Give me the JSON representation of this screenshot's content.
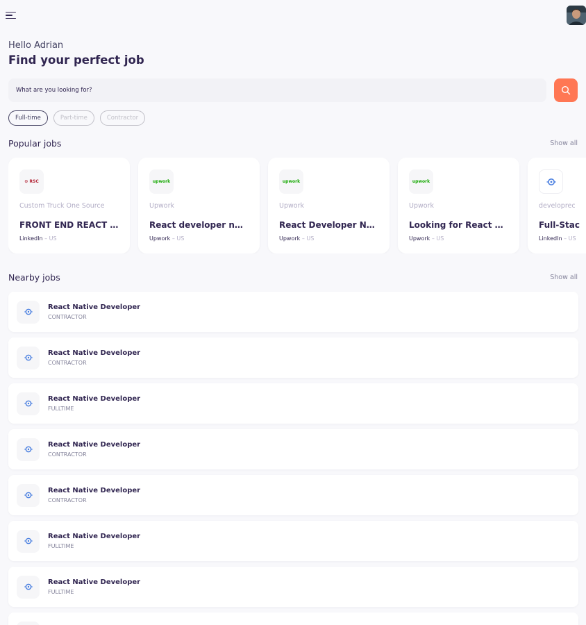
{
  "header": {
    "menu_icon": "menu-icon",
    "avatar_icon": "user-avatar"
  },
  "welcome": {
    "greeting": "Hello Adrian",
    "title": "Find your perfect job"
  },
  "search": {
    "placeholder": "What are you looking for?",
    "button_icon": "search-icon"
  },
  "job_types": [
    {
      "label": "Full-time",
      "active": true
    },
    {
      "label": "Part-time",
      "active": false
    },
    {
      "label": "Contractor",
      "active": false
    }
  ],
  "popular": {
    "title": "Popular jobs",
    "show_all": "Show all",
    "jobs": [
      {
        "logo_text": "⊙ RSC",
        "company": "Custom Truck One Source",
        "title": "FRONT END REACT ...",
        "publisher": "LinkedIn",
        "location": "US"
      },
      {
        "logo_text": "upwork",
        "company": "Upwork",
        "title": "React developer ne...",
        "publisher": "Upwork",
        "location": "US"
      },
      {
        "logo_text": "upwork",
        "company": "Upwork",
        "title": "React Developer Ne...",
        "publisher": "Upwork",
        "location": "US"
      },
      {
        "logo_text": "upwork",
        "company": "Upwork",
        "title": "Looking for React D...",
        "publisher": "Upwork",
        "location": "US"
      },
      {
        "logo_text": "",
        "company": "developrec",
        "title": "Full-Stac",
        "publisher": "LinkedIn",
        "location": "US"
      }
    ]
  },
  "nearby": {
    "title": "Nearby jobs",
    "show_all": "Show all",
    "jobs": [
      {
        "title": "React Native Developer",
        "type": "CONTRACTOR"
      },
      {
        "title": "React Native Developer",
        "type": "CONTRACTOR"
      },
      {
        "title": "React Native Developer",
        "type": "FULLTIME"
      },
      {
        "title": "React Native Developer",
        "type": "CONTRACTOR"
      },
      {
        "title": "React Native Developer",
        "type": "CONTRACTOR"
      },
      {
        "title": "React Native Developer",
        "type": "FULLTIME"
      },
      {
        "title": "React Native Developer",
        "type": "FULLTIME"
      },
      {
        "title": "",
        "type": ""
      }
    ]
  },
  "colors": {
    "primary": "#312651",
    "accent": "#ff7754",
    "background": "#f8f8fb",
    "muted": "#83829a",
    "upwork_green": "#14a800",
    "company_logo_blue": "#4a7fe0"
  }
}
